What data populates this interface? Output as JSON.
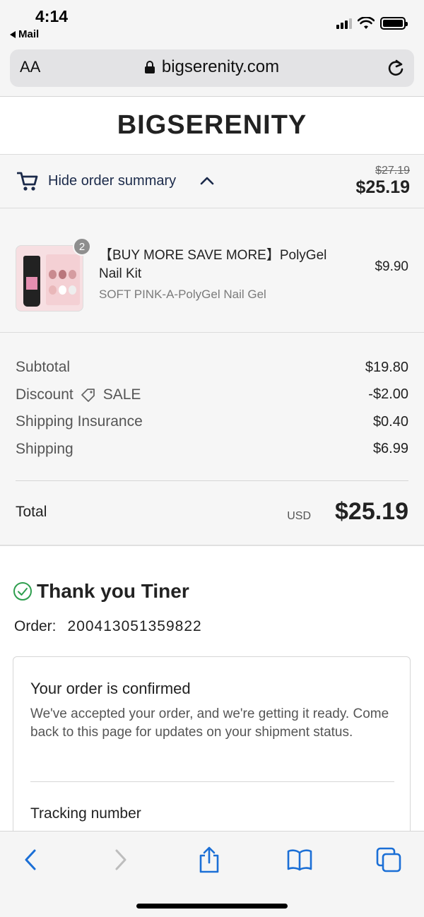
{
  "status_bar": {
    "time": "4:14",
    "back_app": "Mail"
  },
  "address_bar": {
    "text_size_label": "AA",
    "url": "bigserenity.com"
  },
  "store": {
    "name": "BIGSERENITY"
  },
  "order_summary": {
    "toggle_label": "Hide order summary",
    "original_total": "$27.19",
    "total": "$25.19",
    "item": {
      "quantity": "2",
      "title": "【BUY MORE SAVE MORE】PolyGel Nail Kit",
      "variant": "SOFT PINK-A-PolyGel Nail Gel",
      "price": "$9.90"
    },
    "costs": {
      "subtotal_label": "Subtotal",
      "subtotal": "$19.80",
      "discount_label": "Discount",
      "discount_code": "SALE",
      "discount": "-$2.00",
      "insurance_label": "Shipping Insurance",
      "insurance": "$0.40",
      "shipping_label": "Shipping",
      "shipping": "$6.99"
    },
    "total_label": "Total",
    "currency": "USD",
    "grand_total": "$25.19"
  },
  "confirmation": {
    "thank_you": "Thank you Tiner",
    "order_label": "Order:",
    "order_number": "200413051359822",
    "box_title": "Your order is confirmed",
    "box_body": "We've accepted your order, and we're getting it ready. Come back to this page for updates on your shipment status.",
    "tracking_label": "Tracking number"
  },
  "colors": {
    "accent": "#1b6fd6",
    "success": "#2e9e4e",
    "text": "#222222"
  },
  "icons": [
    "cart-icon",
    "chevron-up-icon",
    "tag-icon",
    "check-circle-icon",
    "lock-icon",
    "reload-icon",
    "back-icon",
    "forward-icon",
    "share-icon",
    "bookmarks-icon",
    "tabs-icon"
  ]
}
